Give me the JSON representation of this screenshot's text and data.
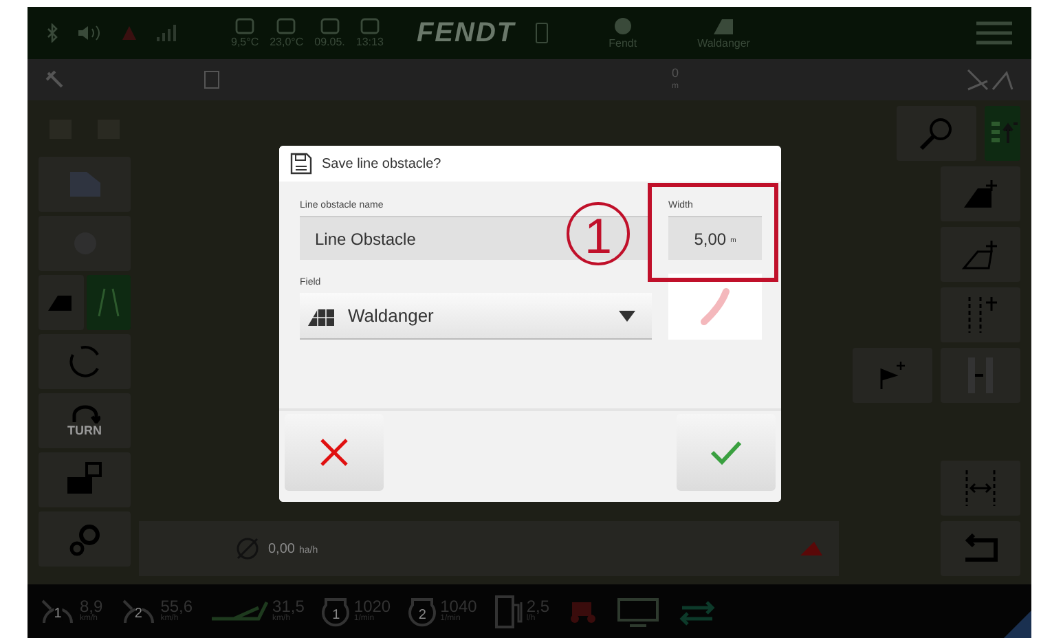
{
  "top_bar": {
    "readings": [
      "9,5°C",
      "23,0°C",
      "09.05.",
      "13:13"
    ],
    "logo": "FENDT",
    "profile": "Fendt",
    "field": "Waldanger"
  },
  "info_bar": {
    "value": "0",
    "unit": "m"
  },
  "left_tools": [
    {
      "kind": "field",
      "selected": false
    },
    {
      "kind": "tracks",
      "selected": true
    }
  ],
  "turn_label": "TURN",
  "status": {
    "value": "0,00",
    "unit": "ha/h"
  },
  "dashboard": [
    {
      "kind": "speed",
      "badge": "1",
      "value": "8,9",
      "unit": "km/h"
    },
    {
      "kind": "speed",
      "badge": "2",
      "value": "55,6",
      "unit": "km/h"
    },
    {
      "kind": "slip",
      "value": "31,5",
      "unit": "km/h"
    },
    {
      "kind": "engine",
      "badge": "1",
      "value": "1020",
      "unit": "1/min"
    },
    {
      "kind": "engine",
      "badge": "2",
      "value": "1040",
      "unit": "1/min"
    },
    {
      "kind": "fuel",
      "value": "2,5",
      "unit": "l/h"
    }
  ],
  "dialog": {
    "title": "Save line obstacle?",
    "name_label": "Line obstacle name",
    "name_value": "Line Obstacle",
    "width_label": "Width",
    "width_value": "5,00",
    "width_unit": "m",
    "field_label": "Field",
    "field_value": "Waldanger"
  },
  "callout": "1"
}
